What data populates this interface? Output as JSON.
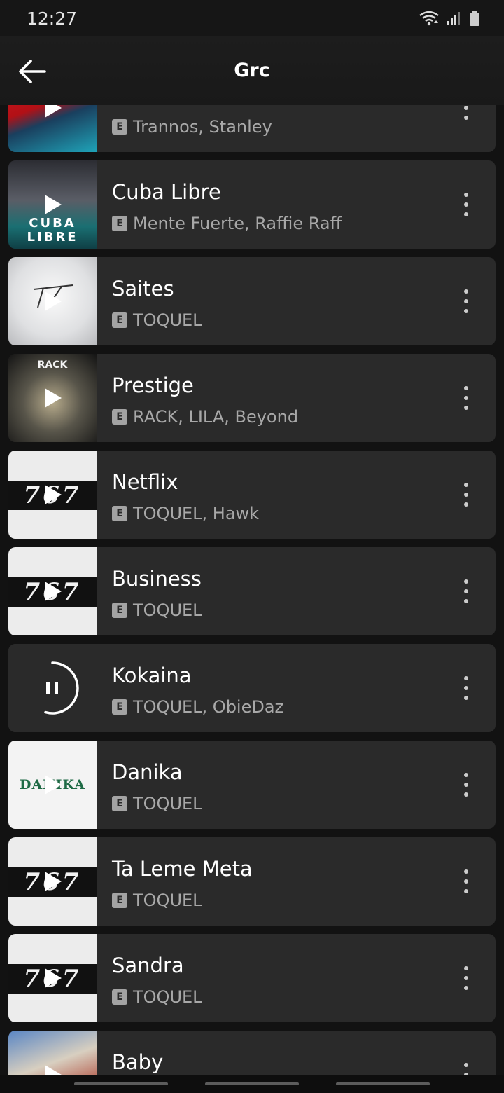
{
  "status_bar": {
    "time": "12:27"
  },
  "header": {
    "title": "Grc"
  },
  "tracks": [
    {
      "title": "",
      "artists": "Trannos, Stanley",
      "explicit": "E"
    },
    {
      "title": "Cuba Libre",
      "artists": "Mente Fuerte, Raffie Raff",
      "explicit": "E"
    },
    {
      "title": "Saites",
      "artists": "TOQUEL",
      "explicit": "E"
    },
    {
      "title": "Prestige",
      "artists": "RACK, LILA, Beyond",
      "explicit": "E"
    },
    {
      "title": "Netflix",
      "artists": "TOQUEL, Hawk",
      "explicit": "E"
    },
    {
      "title": "Business",
      "artists": "TOQUEL",
      "explicit": "E"
    },
    {
      "title": "Kokaina",
      "artists": "TOQUEL, ObieDaz",
      "explicit": "E",
      "state": "playing"
    },
    {
      "title": "Danika",
      "artists": "TOQUEL",
      "explicit": "E"
    },
    {
      "title": "Ta Leme Meta",
      "artists": "TOQUEL",
      "explicit": "E"
    },
    {
      "title": "Sandra",
      "artists": "TOQUEL",
      "explicit": "E"
    },
    {
      "title": "Baby",
      "artists": "",
      "explicit": ""
    }
  ],
  "cover_text": {
    "band_767": "767",
    "danika": "DANIKA",
    "cuba": "CUBA LIBRE",
    "rack": "RACK"
  },
  "colors": {
    "background": "#121212",
    "card": "#2a2a2a",
    "secondary_text": "#a8a8a8"
  }
}
